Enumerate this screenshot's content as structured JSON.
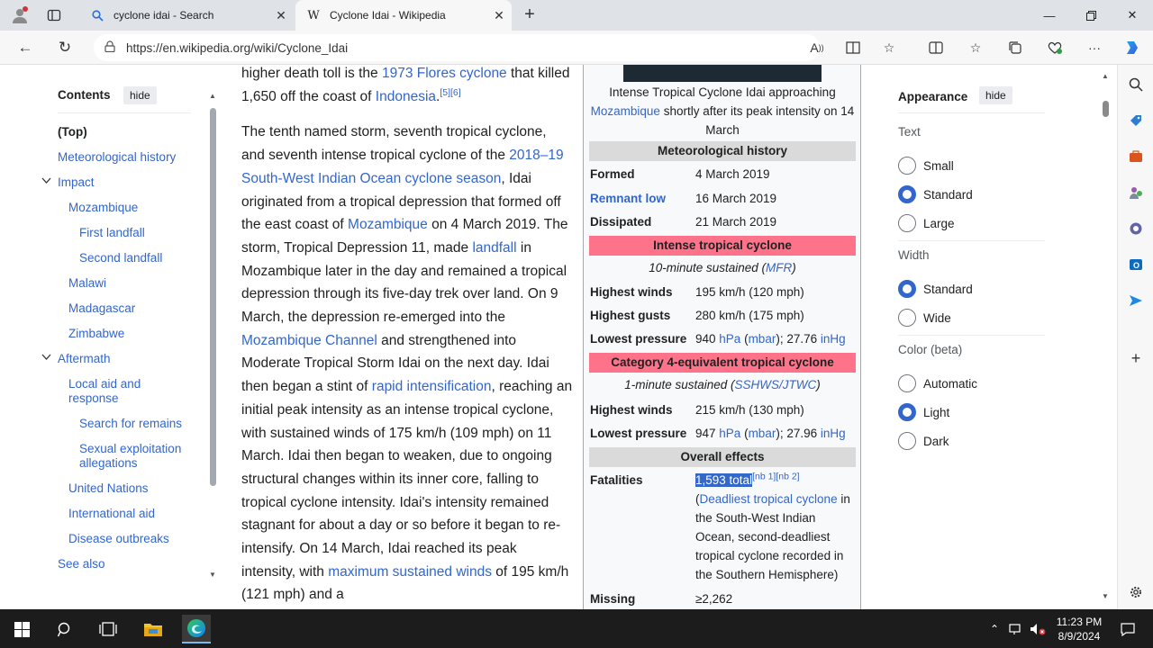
{
  "browser": {
    "tabs": [
      {
        "title": "cyclone idai - Search"
      },
      {
        "title": "Cyclone Idai - Wikipedia"
      }
    ],
    "url": "https://en.wikipedia.org/wiki/Cyclone_Idai"
  },
  "toc": {
    "heading": "Contents",
    "hide": "hide",
    "items": [
      {
        "label": "(Top)"
      },
      {
        "label": "Meteorological history"
      },
      {
        "label": "Impact"
      },
      {
        "label": "Mozambique"
      },
      {
        "label": "First landfall"
      },
      {
        "label": "Second landfall"
      },
      {
        "label": "Malawi"
      },
      {
        "label": "Madagascar"
      },
      {
        "label": "Zimbabwe"
      },
      {
        "label": "Aftermath"
      },
      {
        "label": "Local aid and response"
      },
      {
        "label": "Search for remains"
      },
      {
        "label": "Sexual exploitation allegations"
      },
      {
        "label": "United Nations"
      },
      {
        "label": "International aid"
      },
      {
        "label": "Disease outbreaks"
      },
      {
        "label": "See also"
      }
    ]
  },
  "article": {
    "p1": {
      "t1": "higher death toll is the ",
      "l1": "1973 Flores cyclone",
      "t2": " that killed 1,650 off the coast of ",
      "l2": "Indonesia",
      "t3": ".",
      "ref": "[5][6]"
    },
    "p2": {
      "t1": "The tenth named storm, seventh tropical cyclone, and seventh intense tropical cyclone of the ",
      "l1": "2018–19 South-West Indian Ocean cyclone season",
      "t2": ", Idai originated from a tropical depression that formed off the east coast of ",
      "l2": "Mozambique",
      "t3": " on 4 March 2019. The storm, Tropical Depression 11, made ",
      "l3": "landfall",
      "t4": " in Mozambique later in the day and remained a tropical depression through its five-day trek over land. On 9 March, the depression re-emerged into the ",
      "l4": "Mozambique Channel",
      "t5": " and strengthened into Moderate Tropical Storm Idai on the next day. Idai then began a stint of ",
      "l5": "rapid intensification",
      "t6": ", reaching an initial peak intensity as an intense tropical cyclone, with sustained winds of 175 km/h (109 mph) on 11 March. Idai then began to weaken, due to ongoing structural changes within its inner core, falling to tropical cyclone intensity. Idai's intensity remained stagnant for about a day or so before it began to re-intensify. On 14 March, Idai reached its peak intensity, with ",
      "l6": "maximum sustained winds",
      "t7": " of 195 km/h (121 mph) and a"
    }
  },
  "infobox": {
    "caption_t1": "Intense Tropical Cyclone Idai approaching ",
    "caption_link": "Mozambique",
    "caption_t2": " shortly after its peak intensity on 14 March",
    "met_header": "Meteorological history",
    "formed_label": "Formed",
    "formed_value": "4 March 2019",
    "remnant_label": "Remnant low",
    "remnant_value": "16 March 2019",
    "dissipated_label": "Dissipated",
    "dissipated_value": "21 March 2019",
    "itc_header": "Intense tropical cyclone",
    "itc_sub_t1": "10-minute sustained (",
    "itc_sub_link": "MFR",
    "itc_sub_t2": ")",
    "winds_label": "Highest winds",
    "winds_value": "195 km/h (120 mph)",
    "gusts_label": "Highest gusts",
    "gusts_value": "280 km/h (175 mph)",
    "pressure_label": "Lowest pressure",
    "pressure_value1": "940 ",
    "pressure_hpa": "hPa",
    "pressure_mbar": "mbar",
    "pressure_value2": "; 27.76 ",
    "pressure_inhg": "inHg",
    "cat_header": "Category 4-equivalent tropical cyclone",
    "cat_sub_t1": "1-minute sustained (",
    "cat_sub_link": "SSHWS/JTWC",
    "cat_sub_t2": ")",
    "cat_winds_label": "Highest winds",
    "cat_winds_value": "215 km/h (130 mph)",
    "cat_pressure_label": "Lowest pressure",
    "cat_pressure_value1": "947 ",
    "cat_pressure_hpa": "hPa",
    "cat_pressure_mbar": "mbar",
    "cat_pressure_value2": "; 27.96 ",
    "cat_pressure_inhg": "inHg",
    "effects_header": "Overall effects",
    "fatal_label": "Fatalities",
    "fatal_value": "1,593 total",
    "fatal_ref": "[nb 1][nb 2]",
    "fatal_link": "Deadliest tropical cyclone",
    "fatal_text": " in the South-West Indian Ocean, second-deadliest tropical cyclone recorded in the Southern Hemisphere)",
    "missing_label": "Missing",
    "missing_value": "≥2,262"
  },
  "appearance": {
    "heading": "Appearance",
    "hide": "hide",
    "text_label": "Text",
    "text_options": [
      "Small",
      "Standard",
      "Large"
    ],
    "text_selected": "Standard",
    "width_label": "Width",
    "width_options": [
      "Standard",
      "Wide"
    ],
    "width_selected": "Standard",
    "color_label": "Color (beta)",
    "color_options": [
      "Automatic",
      "Light",
      "Dark"
    ],
    "color_selected": "Light"
  },
  "taskbar": {
    "time": "11:23 PM",
    "date": "8/9/2024"
  },
  "colors": {
    "link": "#3366cc",
    "infobox_pink": "#ff738a",
    "infobox_grey": "#dadada",
    "selection": "#3367c9"
  }
}
